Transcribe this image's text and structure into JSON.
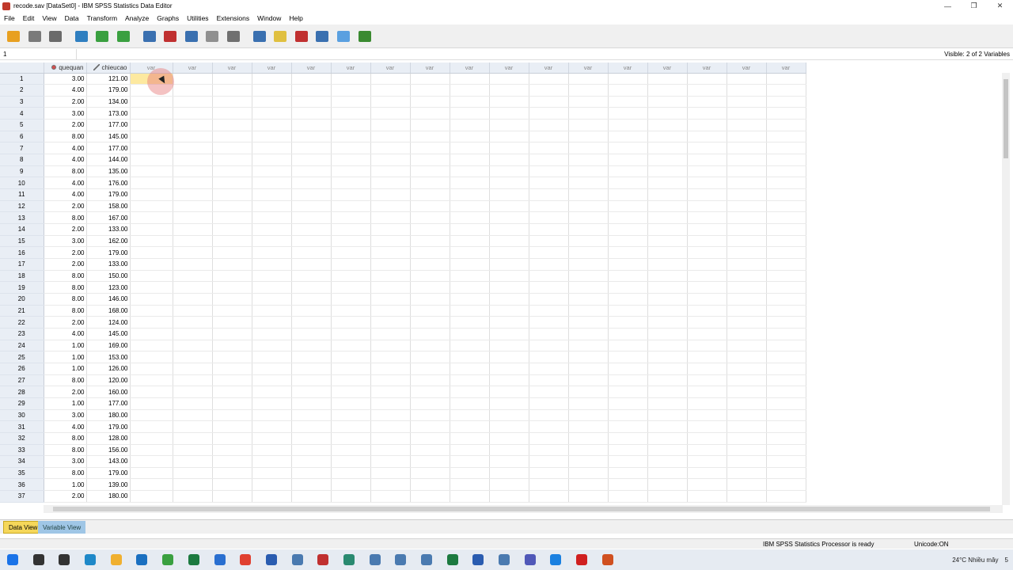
{
  "window": {
    "title": "recode.sav [DataSet0] - IBM SPSS Statistics Data Editor",
    "minimize": "—",
    "restore": "❐",
    "close": "✕"
  },
  "menu": [
    "File",
    "Edit",
    "View",
    "Data",
    "Transform",
    "Analyze",
    "Graphs",
    "Utilities",
    "Extensions",
    "Window",
    "Help"
  ],
  "toolbar": {
    "icons": [
      "open-icon",
      "save-icon",
      "print-icon",
      "dialog-recall-icon",
      "undo-icon",
      "redo-icon",
      "goto-case-icon",
      "goto-variable-icon",
      "variables-icon",
      "run-descriptives-icon",
      "find-icon",
      "insert-cases-icon",
      "insert-variable-icon",
      "split-file-icon",
      "value-labels-icon",
      "use-sets-icon",
      "show-all-icon"
    ]
  },
  "cellbar": {
    "ref": "1",
    "visible_text": "Visible: 2 of 2 Variables"
  },
  "grid": {
    "columns": [
      {
        "name": "quequan",
        "type": "nominal"
      },
      {
        "name": "chieucao",
        "type": "scale"
      }
    ],
    "empty_header": "var",
    "empty_count": 17,
    "rows": [
      [
        "3.00",
        "121.00"
      ],
      [
        "4.00",
        "179.00"
      ],
      [
        "2.00",
        "134.00"
      ],
      [
        "3.00",
        "173.00"
      ],
      [
        "2.00",
        "177.00"
      ],
      [
        "8.00",
        "145.00"
      ],
      [
        "4.00",
        "177.00"
      ],
      [
        "4.00",
        "144.00"
      ],
      [
        "8.00",
        "135.00"
      ],
      [
        "4.00",
        "176.00"
      ],
      [
        "4.00",
        "179.00"
      ],
      [
        "2.00",
        "158.00"
      ],
      [
        "8.00",
        "167.00"
      ],
      [
        "2.00",
        "133.00"
      ],
      [
        "3.00",
        "162.00"
      ],
      [
        "2.00",
        "179.00"
      ],
      [
        "2.00",
        "133.00"
      ],
      [
        "8.00",
        "150.00"
      ],
      [
        "8.00",
        "123.00"
      ],
      [
        "8.00",
        "146.00"
      ],
      [
        "8.00",
        "168.00"
      ],
      [
        "2.00",
        "124.00"
      ],
      [
        "4.00",
        "145.00"
      ],
      [
        "1.00",
        "169.00"
      ],
      [
        "1.00",
        "153.00"
      ],
      [
        "1.00",
        "126.00"
      ],
      [
        "8.00",
        "120.00"
      ],
      [
        "2.00",
        "160.00"
      ],
      [
        "1.00",
        "177.00"
      ],
      [
        "3.00",
        "180.00"
      ],
      [
        "4.00",
        "179.00"
      ],
      [
        "8.00",
        "128.00"
      ],
      [
        "8.00",
        "156.00"
      ],
      [
        "3.00",
        "143.00"
      ],
      [
        "8.00",
        "179.00"
      ],
      [
        "1.00",
        "139.00"
      ],
      [
        "2.00",
        "180.00"
      ]
    ]
  },
  "tabs": {
    "data_view": "Data View",
    "variable_view": "Variable View"
  },
  "status": {
    "processor": "IBM SPSS Statistics Processor is ready",
    "unicode": "Unicode:ON"
  },
  "taskbar": {
    "apps": [
      "windows-start-icon",
      "search-icon",
      "task-view-icon",
      "edge-icon",
      "file-explorer-icon",
      "mail-icon",
      "chrome-green-icon",
      "excel-icon",
      "app-blue-icon",
      "chrome-icon",
      "word-icon",
      "app-icon",
      "spss-icon",
      "app-dots-icon",
      "app-icon",
      "app-icon",
      "app-icon",
      "excel-icon",
      "word-icon",
      "app-icon",
      "teams-icon",
      "zalo-icon",
      "opera-icon",
      "powerpoint-icon"
    ],
    "weather": "24°C  Nhiều mây",
    "clock": "5"
  }
}
